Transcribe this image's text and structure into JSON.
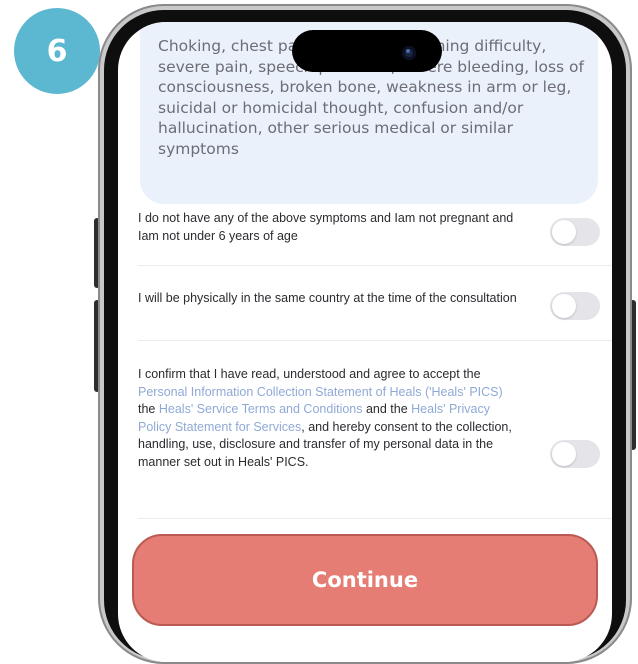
{
  "step_badge": "6",
  "symptoms": {
    "text": "Choking, chest pain, seizures, breathing difficulty, severe pain, speech problems, severe bleeding, loss of consciousness, broken bone, weakness in arm or leg, suicidal or homicidal thought, confusion and/or hallucination, other serious medical or similar symptoms"
  },
  "declarations": [
    {
      "label": "I do not have any of the above symptoms and Iam not pregnant and Iam not under 6 years of age",
      "enabled": false
    },
    {
      "label": "I will be physically in the same country at the time of the consultation",
      "enabled": false
    }
  ],
  "consent": {
    "part1": "I confirm that I have read, understood and agree to accept the ",
    "link1": "Personal Information Collection Statement of Heals ('Heals' PICS)",
    "part2": " the ",
    "link2": "Heals' Service Terms and Conditions",
    "part3": " and the ",
    "link3": "Heals' Privacy Policy Statement for Services",
    "part4": ", and hereby consent to the collection, handling, use, disclosure and transfer of my personal data in the manner set out in Heals' PICS.",
    "enabled": false
  },
  "continue_label": "Continue",
  "colors": {
    "badge": "#5cb7d0",
    "continue_button": "#e57d75",
    "link": "#8fa9d6",
    "symptom_card": "#eaf1fb"
  }
}
